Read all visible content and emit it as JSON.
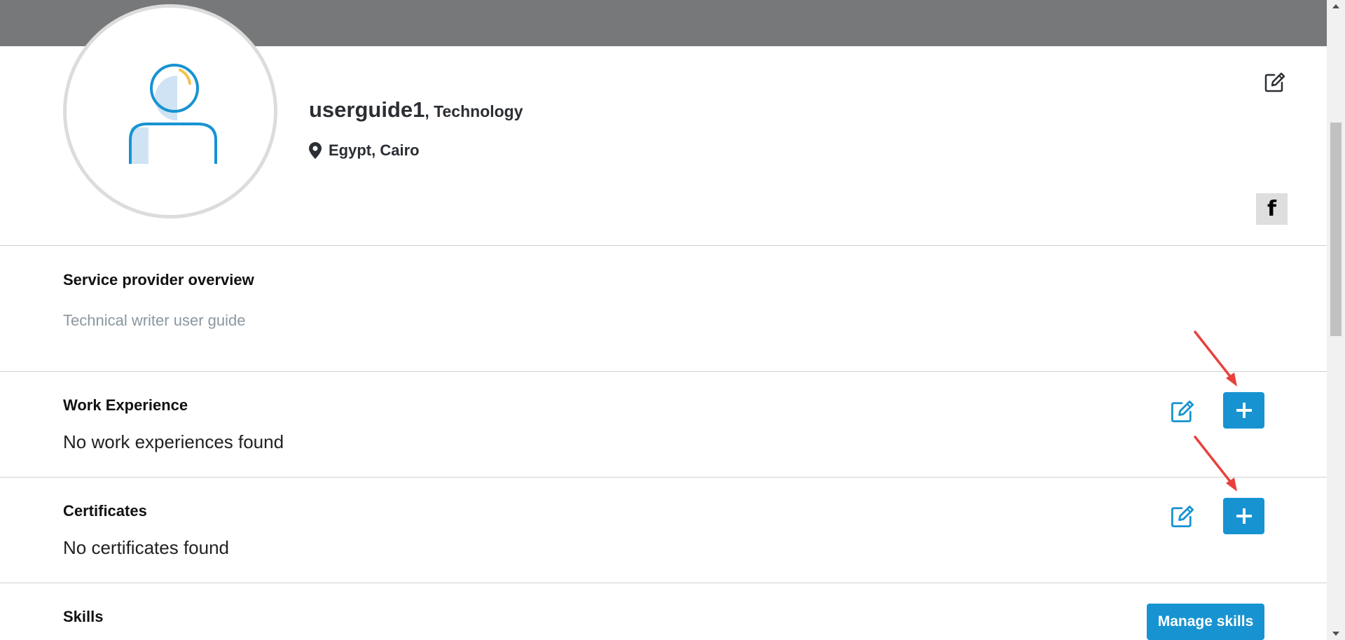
{
  "profile": {
    "username": "userguide1",
    "sector": ", Technology",
    "location": "Egypt, Cairo"
  },
  "overview": {
    "title": "Service provider overview",
    "text": "Technical writer user guide"
  },
  "work_experience": {
    "title": "Work Experience",
    "empty_text": "No work experiences found"
  },
  "certificates": {
    "title": "Certificates",
    "empty_text": "No certificates found"
  },
  "skills": {
    "title": "Skills",
    "manage_label": "Manage skills"
  },
  "social": {
    "facebook_glyph": "f"
  },
  "icons": {
    "edit": "edit-icon",
    "add": "plus-icon",
    "location": "map-pin-icon",
    "facebook": "facebook-icon"
  },
  "colors": {
    "banner": "#77787a",
    "accent": "#1793d1",
    "annotation_arrow": "#e8413c"
  }
}
